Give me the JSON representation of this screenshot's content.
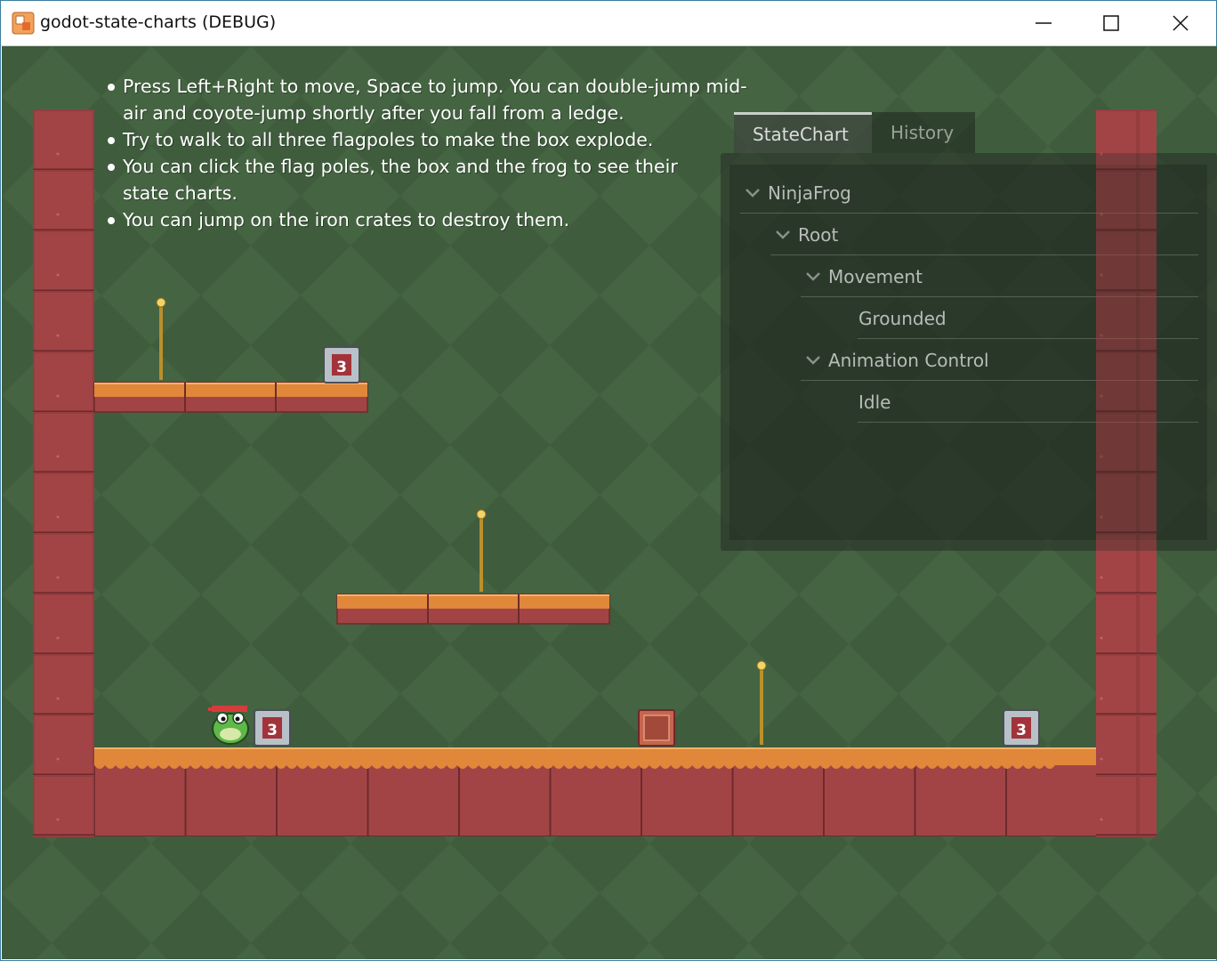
{
  "window": {
    "title": "godot-state-charts (DEBUG)",
    "controls": {
      "minimize": "minimize-icon",
      "maximize": "maximize-icon",
      "close": "close-icon"
    }
  },
  "game": {
    "background_color": "#3f5c3d",
    "instructions": [
      "Press Left+Right to move, Space to jump. You can double-jump mid-air and coyote-jump shortly after you fall from a ledge.",
      "Try to walk to all three flagpoles to make the box explode.",
      "You can click the flag poles, the box and the frog to see their state charts.",
      "You can jump on the iron crates to destroy them."
    ],
    "crate_counts": {
      "upper_crate": "3",
      "frog_crate": "3",
      "right_crate": "3"
    }
  },
  "state_chart_debugger": {
    "tabs": [
      {
        "label": "StateChart",
        "active": true
      },
      {
        "label": "History",
        "active": false
      }
    ],
    "tree": [
      {
        "label": "NinjaFrog",
        "expanded": true
      },
      {
        "label": "Root",
        "expanded": true
      },
      {
        "label": "Movement",
        "expanded": true
      },
      {
        "label": "Grounded",
        "expanded": false
      },
      {
        "label": "Animation Control",
        "expanded": true
      },
      {
        "label": "Idle",
        "expanded": false
      }
    ]
  },
  "colors": {
    "brick": "#a7484a",
    "grass": "#e0873a",
    "panel": "#2a322a"
  }
}
